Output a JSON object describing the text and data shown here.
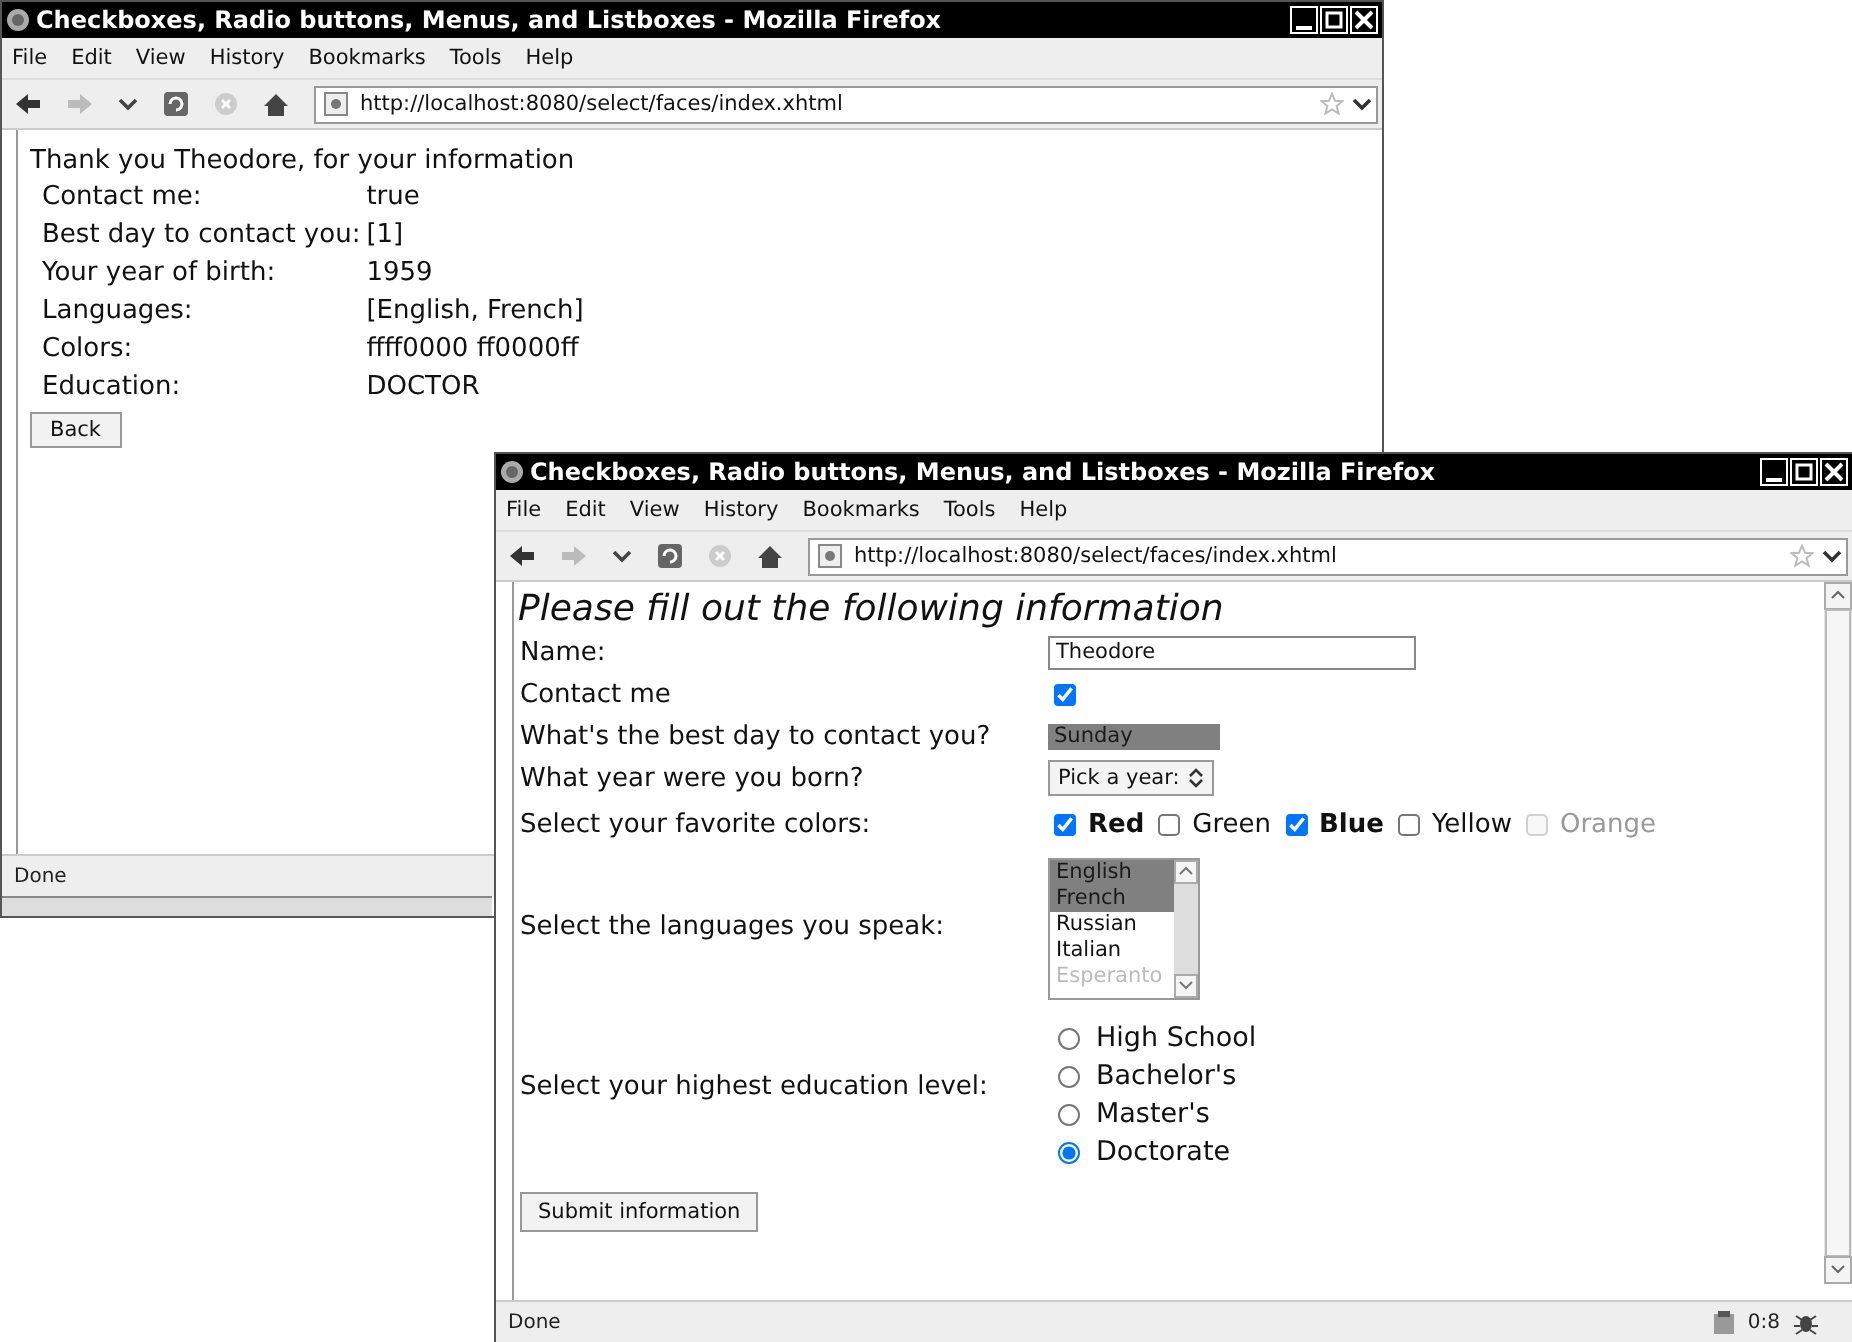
{
  "results_window": {
    "title": "Checkboxes, Radio buttons, Menus, and Listboxes - Mozilla Firefox",
    "menu": [
      "File",
      "Edit",
      "View",
      "History",
      "Bookmarks",
      "Tools",
      "Help"
    ],
    "address": "http://localhost:8080/select/faces/index.xhtml",
    "heading": "Thank you Theodore, for your information",
    "rows": [
      {
        "label": "Contact me:",
        "value": "true"
      },
      {
        "label": "Best day to contact you:",
        "value": "[1]"
      },
      {
        "label": "Your year of birth:",
        "value": "1959"
      },
      {
        "label": "Languages:",
        "value": "[English, French]"
      },
      {
        "label": "Colors:",
        "value": "ffff0000 ff0000ff"
      },
      {
        "label": "Education:",
        "value": "DOCTOR"
      }
    ],
    "button": "Back",
    "status": "Done"
  },
  "form_window": {
    "title": "Checkboxes, Radio buttons, Menus, and Listboxes - Mozilla Firefox",
    "menu": [
      "File",
      "Edit",
      "View",
      "History",
      "Bookmarks",
      "Tools",
      "Help"
    ],
    "address": "http://localhost:8080/select/faces/index.xhtml",
    "heading": "Please fill out the following information",
    "fields": [
      {
        "kind": "text",
        "label": "Name:",
        "value": "Theodore"
      },
      {
        "kind": "checkbox",
        "label": "Contact me",
        "checked": true
      },
      {
        "kind": "listbox",
        "label": "What's the best day to contact you?",
        "options": [
          {
            "text": "Sunday",
            "selected": true,
            "disabled": false
          }
        ]
      },
      {
        "kind": "dropdown",
        "label": "What year were you born?",
        "value": "Pick a year:"
      },
      {
        "kind": "checkgroup",
        "label": "Select your favorite colors:",
        "options": [
          {
            "text": "Red",
            "checked": true,
            "disabled": false
          },
          {
            "text": "Green",
            "checked": false,
            "disabled": false
          },
          {
            "text": "Blue",
            "checked": true,
            "disabled": false
          },
          {
            "text": "Yellow",
            "checked": false,
            "disabled": false
          },
          {
            "text": "Orange",
            "checked": false,
            "disabled": true
          }
        ]
      },
      {
        "kind": "scrolllist",
        "label": "Select the languages you speak:",
        "options": [
          {
            "text": "English",
            "selected": true,
            "disabled": false
          },
          {
            "text": "French",
            "selected": true,
            "disabled": false
          },
          {
            "text": "Russian",
            "selected": false,
            "disabled": false
          },
          {
            "text": "Italian",
            "selected": false,
            "disabled": false
          },
          {
            "text": "Esperanto",
            "selected": false,
            "disabled": true
          }
        ]
      },
      {
        "kind": "radio",
        "label": "Select your highest education level:",
        "options": [
          {
            "text": "High School",
            "selected": false
          },
          {
            "text": "Bachelor's",
            "selected": false
          },
          {
            "text": "Master's",
            "selected": false
          },
          {
            "text": "Doctorate",
            "selected": true
          }
        ]
      }
    ],
    "button": "Submit information",
    "status": "Done",
    "status_time": "0:8"
  }
}
